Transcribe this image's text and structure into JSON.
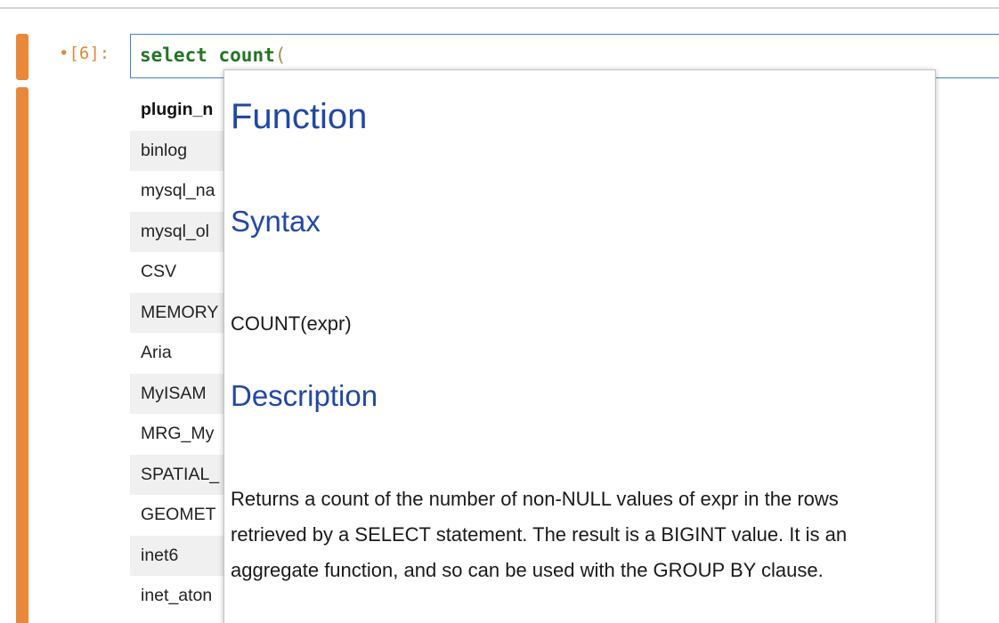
{
  "cell": {
    "prompt": "•[6]:",
    "code_keyword_1": "select",
    "code_keyword_2": "count",
    "code_paren": "("
  },
  "output_table": {
    "header": "plugin_n",
    "rows": [
      "binlog",
      "mysql_na",
      "mysql_ol",
      "CSV",
      "MEMORY",
      "Aria",
      "MyISAM",
      "MRG_My",
      "SPATIAL_",
      "GEOMET",
      "inet6",
      "inet_aton"
    ]
  },
  "tooltip": {
    "heading": "Function",
    "syntax_heading": "Syntax",
    "syntax": "COUNT(expr)",
    "description_heading": "Description",
    "description": "Returns a count of the number of non-NULL values of expr in the rows retrieved by a SELECT statement. The result is a BIGINT value. It is an aggregate function, and so can be used with the GROUP BY clause."
  },
  "colors": {
    "collapser": "#e8883a",
    "prompt": "#e08a3a",
    "editor_border": "#3c82d8",
    "keyword": "#237522",
    "heading": "#2148a5"
  }
}
